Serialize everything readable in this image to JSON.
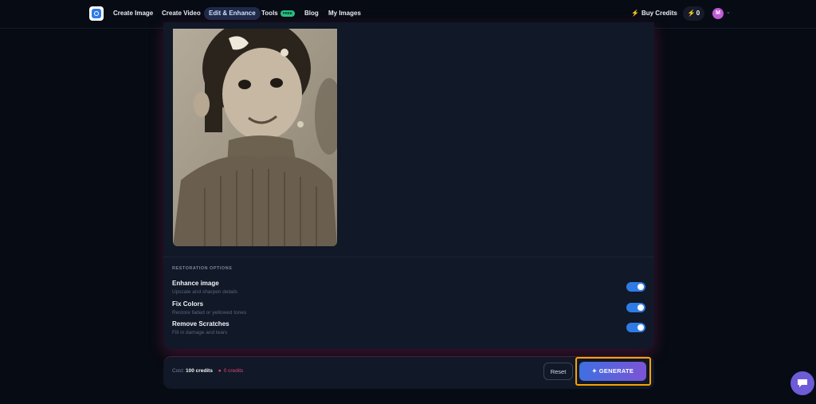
{
  "nav": {
    "links": [
      "Create Image",
      "Create Video",
      "Edit & Enhance",
      "Tools",
      "Blog",
      "My Images"
    ],
    "tools_badge": "FREE",
    "buy_credits": "Buy Credits",
    "credits": "0",
    "avatar_initial": "M"
  },
  "restoration": {
    "section_label": "RESTORATION OPTIONS",
    "options": [
      {
        "title": "Enhance image",
        "description": "Upscale and sharpen details",
        "enabled": true
      },
      {
        "title": "Fix Colors",
        "description": "Restore faded or yellowed tones",
        "enabled": true
      },
      {
        "title": "Remove Scratches",
        "description": "Fill in damage and tears",
        "enabled": true
      }
    ]
  },
  "footer": {
    "cost_label": "Cost:",
    "cost_value": "100 credits",
    "balance": "0 credits",
    "reset_label": "Reset",
    "generate_label": "GENERATE"
  },
  "colors": {
    "accent": "#2f7be6",
    "highlight": "#f5a300",
    "warning": "#e0457b"
  }
}
